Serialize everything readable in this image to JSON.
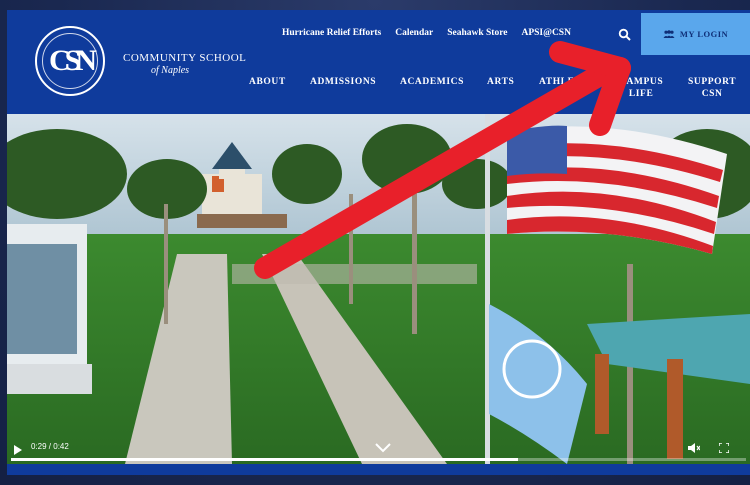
{
  "school": {
    "seal_monogram": "CSN",
    "name_line1": "COMMUNITY SCHOOL",
    "name_line2": "of Naples"
  },
  "utility_nav": [
    {
      "label": "Hurricane Relief Efforts"
    },
    {
      "label": "Calendar"
    },
    {
      "label": "Seahawk Store"
    },
    {
      "label": "APSI@CSN"
    }
  ],
  "login": {
    "label": "MY LOGIN"
  },
  "main_nav": [
    {
      "line1": "ABOUT",
      "line2": ""
    },
    {
      "line1": "ADMISSIONS",
      "line2": ""
    },
    {
      "line1": "ACADEMICS",
      "line2": ""
    },
    {
      "line1": "ARTS",
      "line2": ""
    },
    {
      "line1": "ATHLETICS",
      "line2": ""
    },
    {
      "line1": "CAMPUS",
      "line2": "LIFE"
    },
    {
      "line1": "SUPPORT",
      "line2": "CSN"
    }
  ],
  "video": {
    "time": "0:29 / 0:42",
    "progress": 0.69
  },
  "colors": {
    "header_bg": "#0f3b9c",
    "login_bg": "#5aa7ec",
    "annotation_arrow": "#e8202a"
  },
  "icons": [
    "search-icon",
    "user-group-icon",
    "play-icon",
    "chevron-down-icon",
    "volume-icon",
    "fullscreen-icon"
  ]
}
